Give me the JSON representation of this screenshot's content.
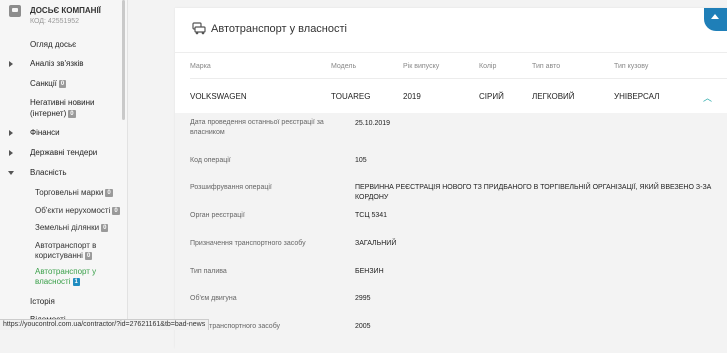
{
  "sidebar": {
    "company_title": "ДОСЬЄ КОМПАНІЇ",
    "company_code": "КОД: 42551952",
    "items": [
      {
        "label": "Огляд досьє"
      },
      {
        "label": "Аналіз зв'язків"
      },
      {
        "label": "Санкції",
        "badge": "0"
      },
      {
        "label": "Негативні новини",
        "label2": "(інтернет)",
        "badge": "0"
      },
      {
        "label": "Фінанси"
      },
      {
        "label": "Державні тендери"
      },
      {
        "label": "Власність"
      },
      {
        "label": "Історія"
      },
      {
        "label": "Відомості"
      }
    ],
    "sub_items": [
      {
        "label": "Торговельні марки",
        "badge": "0"
      },
      {
        "label": "Об'єкти нерухомості",
        "badge": "0"
      },
      {
        "label": "Земельні ділянки",
        "badge": "0"
      },
      {
        "label": "Автотранспорт в",
        "label2": "користуванні",
        "badge": "0"
      },
      {
        "label": "Автотранспорт у",
        "label2": "власності",
        "badge": "1"
      }
    ]
  },
  "card": {
    "title": "Автотранспорт у власності",
    "columns": [
      "Марка",
      "Модель",
      "Рік випуску",
      "Колір",
      "Тип авто",
      "Тип кузову"
    ],
    "row": [
      "VOLKSWAGEN",
      "TOUAREG",
      "2019",
      "СІРИЙ",
      "ЛЕГКОВИЙ",
      "УНІВЕРСАЛ"
    ],
    "expand_icon": "chevron-up-icon",
    "details": [
      {
        "label": "Дата проведення останньої реєстрації за",
        "label2": "власником",
        "value": "25.10.2019"
      },
      {
        "label": "Код операції",
        "value": "105"
      },
      {
        "label": "Розшифрування операції",
        "value": "ПЕРВИННА РЕЄСТРАЦІЯ НОВОГО ТЗ ПРИДБАНОГО В ТОРГІВЕЛЬНІЙ ОРГАНІЗАЦІЇ, ЯКИЙ ВВЕЗЕНО З-ЗА КОРДОНУ"
      },
      {
        "label": "Орган реєстрації",
        "value": "ТСЦ 5341"
      },
      {
        "label": "Призначення транспортного засобу",
        "value": "ЗАГАЛЬНИЙ"
      },
      {
        "label": "Тип палива",
        "value": "БЕНЗИН"
      },
      {
        "label": "Об'єм двигуна",
        "value": "2995"
      },
      {
        "label": "Маса транспортного засобу",
        "value": "2005"
      }
    ]
  },
  "statusbar": {
    "url": "https://youcontrol.com.ua/contractor/?id=27621161&tb=bad-news"
  },
  "colors": {
    "accent_blue": "#1f7fb8",
    "active_green": "#3aa04a",
    "chevron_teal": "#27a9a9"
  }
}
